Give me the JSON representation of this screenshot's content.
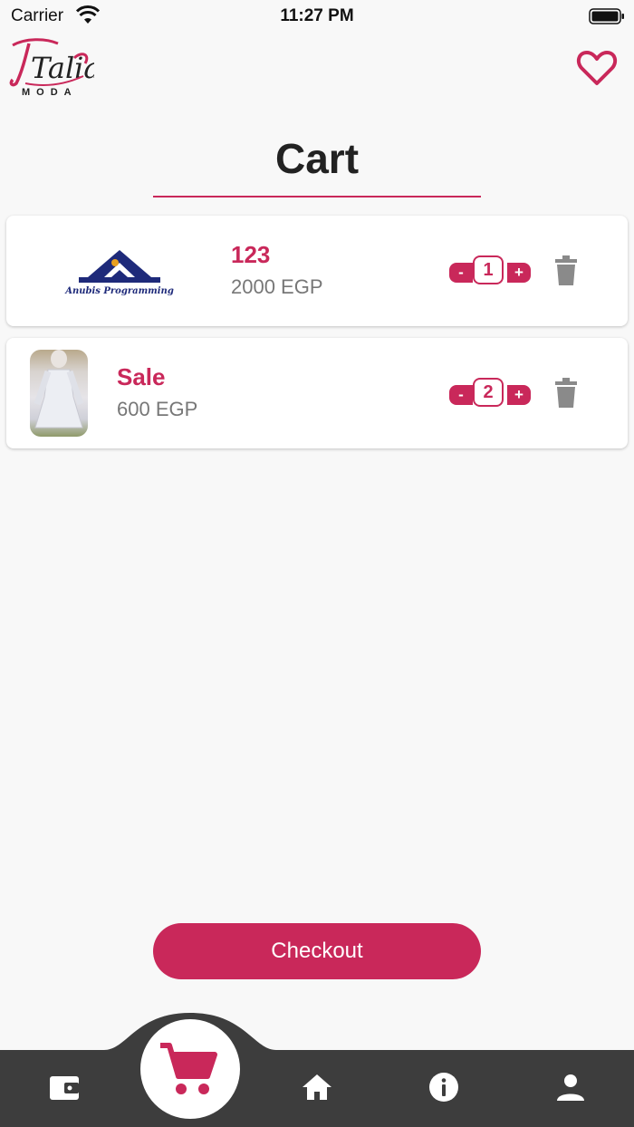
{
  "status_bar": {
    "carrier": "Carrier",
    "time": "11:27 PM"
  },
  "header": {
    "logo_text": "Talia",
    "logo_subtext": "MODA",
    "favorites_icon": "heart-outline-icon"
  },
  "page": {
    "title": "Cart"
  },
  "cart_items": [
    {
      "name": "123",
      "price": "2000 EGP",
      "quantity": "1",
      "minus": "-",
      "plus": "+",
      "image": "Anubis Programming logo",
      "logo_caption": "Anubis Programming"
    },
    {
      "name": "Sale",
      "price": "600 EGP",
      "quantity": "2",
      "minus": "-",
      "plus": "+",
      "image": "white dress photo"
    }
  ],
  "checkout": {
    "label": "Checkout"
  },
  "bottom_nav": {
    "items": [
      {
        "icon": "wallet-icon"
      },
      {
        "icon": "cart-icon",
        "active": true
      },
      {
        "icon": "home-icon"
      },
      {
        "icon": "info-icon"
      },
      {
        "icon": "person-icon"
      }
    ]
  },
  "colors": {
    "accent": "#c9285a",
    "nav_bg": "#3d3d3d",
    "background": "#f8f8f8",
    "muted": "#777777"
  }
}
